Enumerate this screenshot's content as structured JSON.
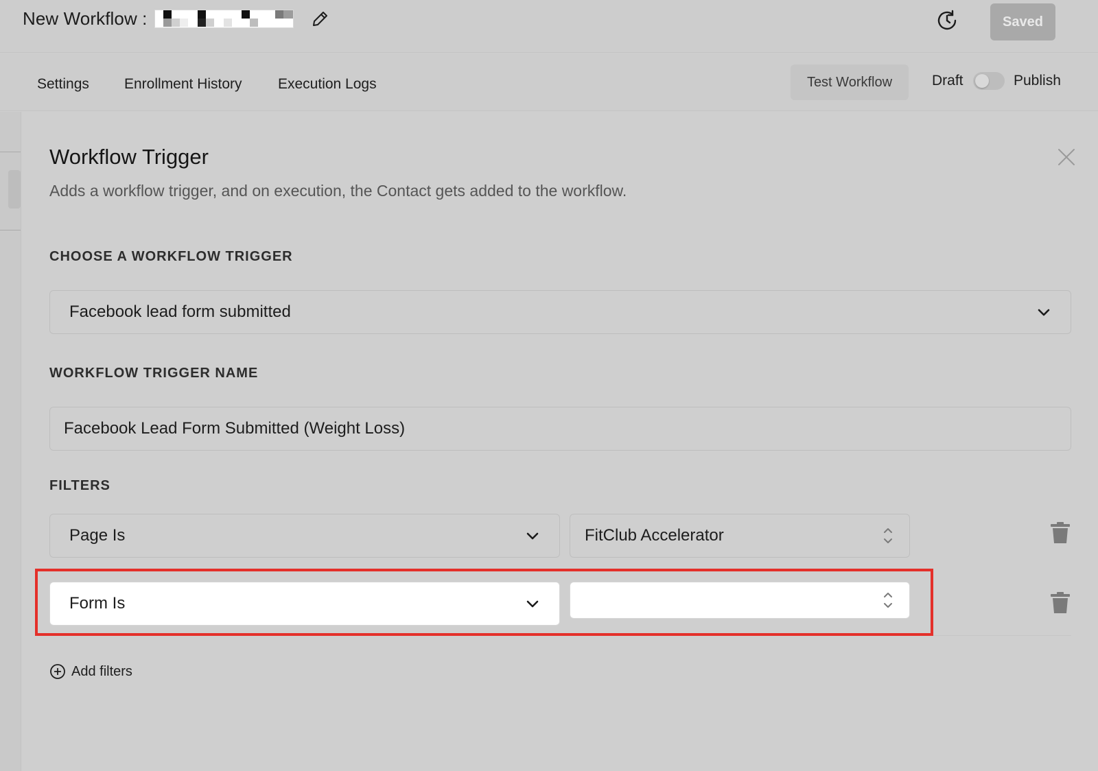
{
  "header": {
    "title": "New Workflow :",
    "edit_icon": "pencil-icon",
    "history_icon": "history-icon",
    "saved_label": "Saved"
  },
  "tabs": [
    {
      "label": "Settings"
    },
    {
      "label": "Enrollment History"
    },
    {
      "label": "Execution Logs"
    }
  ],
  "toolbar": {
    "test_label": "Test Workflow",
    "draft_label": "Draft",
    "publish_label": "Publish",
    "published": false
  },
  "panel": {
    "title": "Workflow Trigger",
    "description": "Adds a workflow trigger, and on execution, the Contact gets added to the workflow.",
    "choose_label": "CHOOSE A WORKFLOW TRIGGER",
    "trigger_value": "Facebook lead form submitted",
    "name_label": "WORKFLOW TRIGGER NAME",
    "name_value": "Facebook Lead Form Submitted (Weight Loss)",
    "filters_label": "FILTERS",
    "filters": [
      {
        "field": "Page Is",
        "value": "FitClub Accelerator"
      },
      {
        "field": "Form Is",
        "value": ""
      }
    ],
    "add_filters_label": "Add filters"
  },
  "colors": {
    "highlight": "#e4302a",
    "background": "#cfcfcf"
  }
}
